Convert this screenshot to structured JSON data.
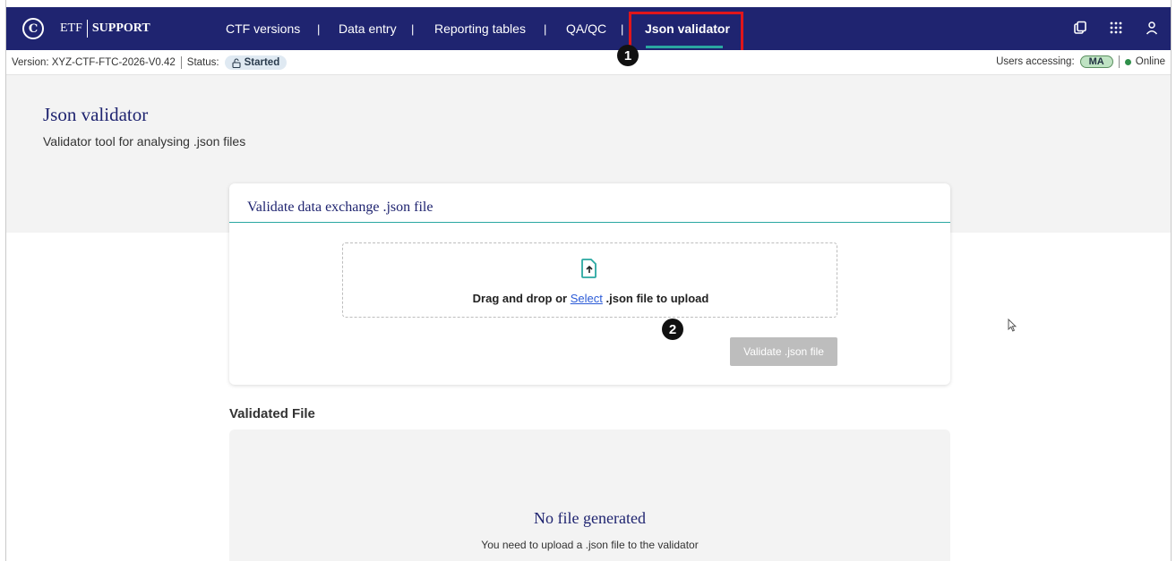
{
  "brand": {
    "etf": "ETF",
    "support": "SUPPORT"
  },
  "nav": {
    "items": [
      {
        "label": "CTF versions"
      },
      {
        "label": "Data entry"
      },
      {
        "label": "Reporting tables"
      },
      {
        "label": "QA/QC"
      },
      {
        "label": "Json validator"
      }
    ],
    "separator": "|"
  },
  "status": {
    "version_label": "Version: XYZ-CTF-FTC-2026-V0.42",
    "status_label": "Status:",
    "status_value": "Started",
    "users_label": "Users accessing:",
    "user_initials": "MA",
    "online_label": "Online"
  },
  "page": {
    "title": "Json validator",
    "subtitle": "Validator tool for analysing .json files"
  },
  "card": {
    "title": "Validate data exchange .json file",
    "drop_prefix": "Drag and drop or",
    "drop_link": "Select",
    "drop_suffix": ".json file to upload",
    "validate_button": "Validate .json file"
  },
  "validated": {
    "heading": "Validated File",
    "empty_title": "No file generated",
    "empty_sub": "You need to upload a .json file to the validator"
  },
  "markers": [
    "1",
    "2"
  ],
  "colors": {
    "nav_bg": "#1f2470",
    "accent_teal": "#2aa7a1",
    "highlight_red": "#e0161b",
    "link_blue": "#2b5bd7"
  }
}
